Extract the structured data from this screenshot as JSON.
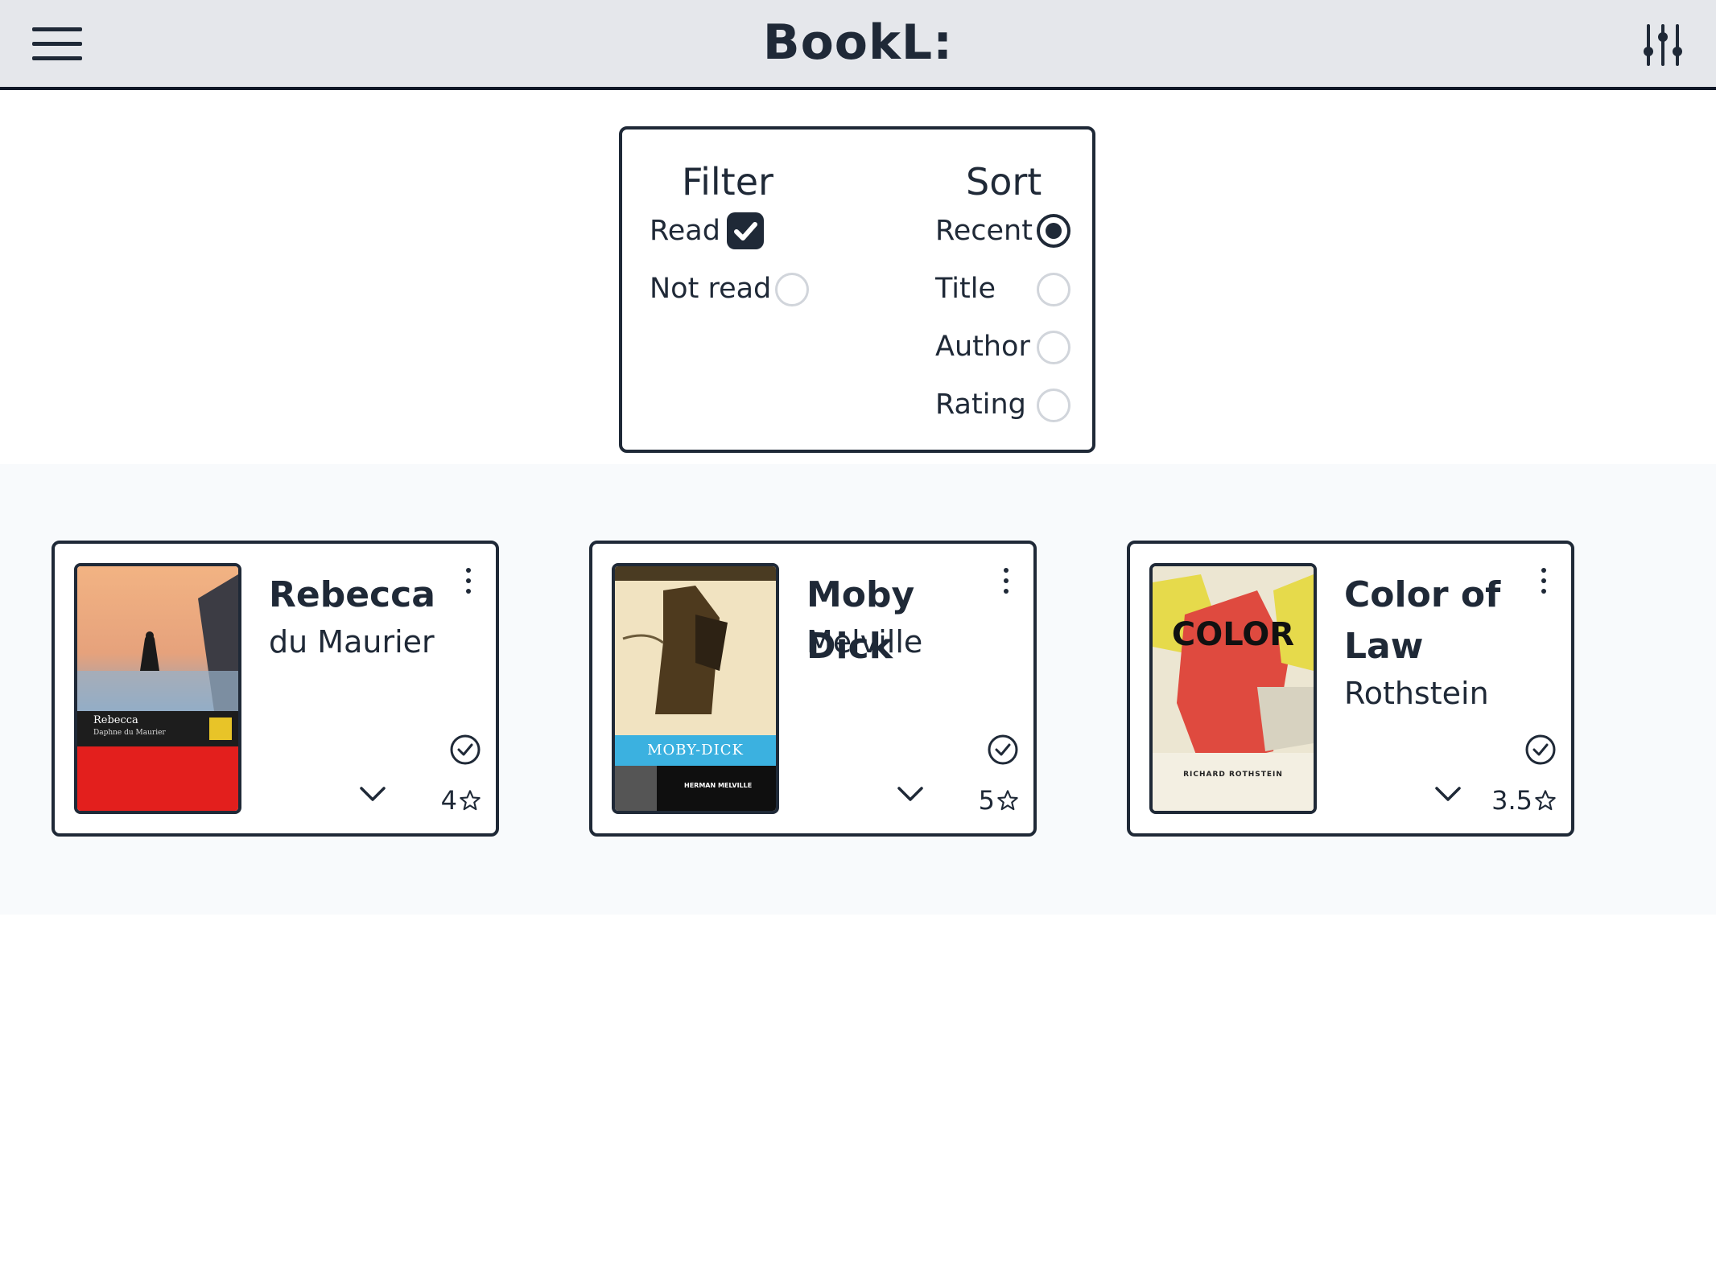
{
  "app": {
    "title": "BookL:"
  },
  "header": {
    "menu_icon": "hamburger-menu-icon",
    "settings_icon": "sliders-icon"
  },
  "panel": {
    "filter": {
      "title": "Filter",
      "options": [
        {
          "label": "Read",
          "checked": true
        },
        {
          "label": "Not read",
          "checked": false
        }
      ]
    },
    "sort": {
      "title": "Sort",
      "options": [
        {
          "label": "Recent",
          "selected": true
        },
        {
          "label": "Title",
          "selected": false
        },
        {
          "label": "Author",
          "selected": false
        },
        {
          "label": "Rating",
          "selected": false
        }
      ]
    }
  },
  "books": [
    {
      "title": "Rebecca",
      "author": "du Maurier",
      "rating": "4",
      "read": true,
      "cover": {
        "title": "Rebecca",
        "subtitle": "Daphne du Maurier",
        "colors": [
          "#f0a878",
          "#1c1c1c",
          "#e0201e"
        ]
      }
    },
    {
      "title": "Moby Dick",
      "author": "Melville",
      "rating": "5",
      "read": true,
      "cover": {
        "title": "MOBY-DICK",
        "subtitle": "HERMAN MELVILLE",
        "colors": [
          "#f2e4c4",
          "#3bb0e0",
          "#111111"
        ]
      }
    },
    {
      "title": "Color of Law",
      "author": "Rothstein",
      "rating": "3.5",
      "read": true,
      "cover": {
        "title": "COLOR",
        "subtitle": "RICHARD ROTHSTEIN",
        "colors": [
          "#e9e3cf",
          "#e0453b",
          "#e6d94a"
        ]
      }
    }
  ]
}
